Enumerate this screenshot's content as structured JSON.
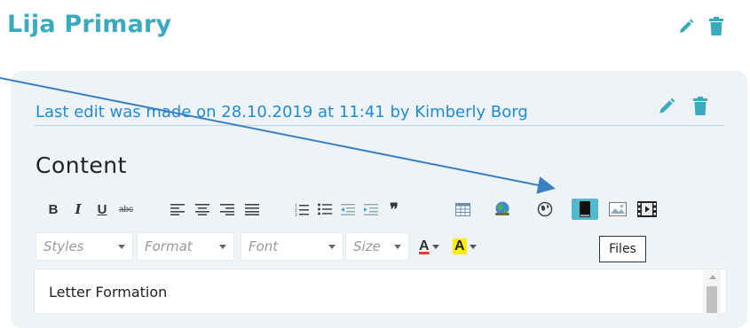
{
  "header": {
    "title": "Lija Primary"
  },
  "card": {
    "last_edit": "Last edit was made on 28.10.2019 at 11:41 by Kimberly Borg",
    "content_heading": "Content"
  },
  "toolbar": {
    "bold": "B",
    "italic": "I",
    "underline": "U",
    "strike": "abc",
    "blockquote": "❞",
    "active_tool": "files"
  },
  "format_bar": {
    "styles": "Styles",
    "format": "Format",
    "font": "Font",
    "size": "Size",
    "text_color_glyph": "A",
    "bg_color_glyph": "A"
  },
  "tooltip": {
    "text": "Files"
  },
  "editor": {
    "text": "Letter Formation"
  },
  "colors": {
    "brand": "#3aaabf",
    "link": "#1f8bd6",
    "active_tool": "#4fb9ce",
    "arrow": "#3a7fc1"
  }
}
